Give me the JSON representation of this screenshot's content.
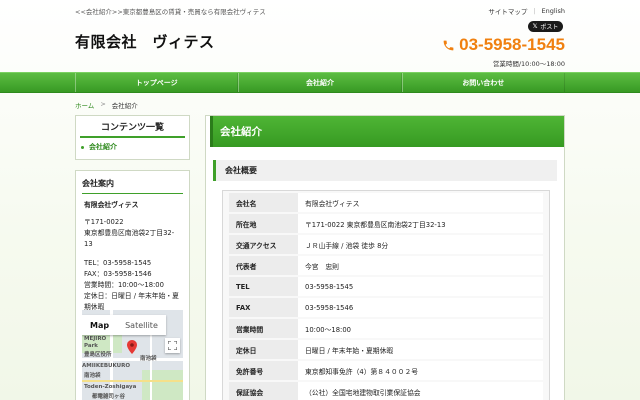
{
  "header": {
    "tagline": "<<会社紹介>>東京都豊島区の賃貸・売買なら有限会社ヴィテス",
    "sitemap": "サイトマップ",
    "english": "English",
    "x_post": "ポスト",
    "logo": "有限会社　ヴィテス",
    "phone": "03-5958-1545",
    "hours": "営業時間/10:00〜18:00"
  },
  "nav": {
    "items": [
      "トップページ",
      "会社紹介",
      "お問い合わせ"
    ]
  },
  "breadcrumb": {
    "home": "ホーム",
    "separator": ">",
    "current": "会社紹介"
  },
  "sidebar": {
    "contents_title": "コンテンツ一覧",
    "contents_items": [
      "会社紹介"
    ],
    "info_title": "会社案内",
    "company_name": "有限会社ヴィテス",
    "postal": "〒171-0022",
    "address": "東京都豊島区南池袋2丁目32-13",
    "tel": "TEL：03-5958-1545",
    "fax": "FAX：03-5958-1546",
    "hours": "営業時間：10:00〜18:00",
    "holiday_1": "定休日：日曜日 / 年末年始・夏",
    "holiday_2": "期休暇",
    "map_tabs": [
      "Map",
      "Satellite"
    ],
    "map_labels": [
      "MEJIRO",
      "Park",
      "豊島区役所",
      "南池袋",
      "AMIIKEBUKURO",
      "南池袋",
      "Toden-Zoshigaya",
      "都電雑司ヶ谷"
    ]
  },
  "main": {
    "page_title": "会社紹介",
    "section_title": "会社概要",
    "rows": [
      {
        "key": "会社名",
        "value": "有限会社ヴィテス"
      },
      {
        "key": "所在地",
        "value": "〒171-0022 東京都豊島区南池袋2丁目32-13"
      },
      {
        "key": "交通アクセス",
        "value": "ＪＲ山手線 / 池袋 徒歩 8分"
      },
      {
        "key": "代表者",
        "value": "今宮　忠則"
      },
      {
        "key": "TEL",
        "value": "03-5958-1545"
      },
      {
        "key": "FAX",
        "value": "03-5958-1546"
      },
      {
        "key": "営業時間",
        "value": "10:00〜18:00"
      },
      {
        "key": "定休日",
        "value": "日曜日 / 年末年始・夏期休暇"
      },
      {
        "key": "免許番号",
        "value": "東京都知事免許（4）第８４００２号"
      },
      {
        "key": "保証協会",
        "value": "（公社）全国宅地建物取引業保証協会"
      }
    ]
  },
  "colors": {
    "accent_green": "#3fa02a",
    "phone_orange": "#f08010"
  }
}
